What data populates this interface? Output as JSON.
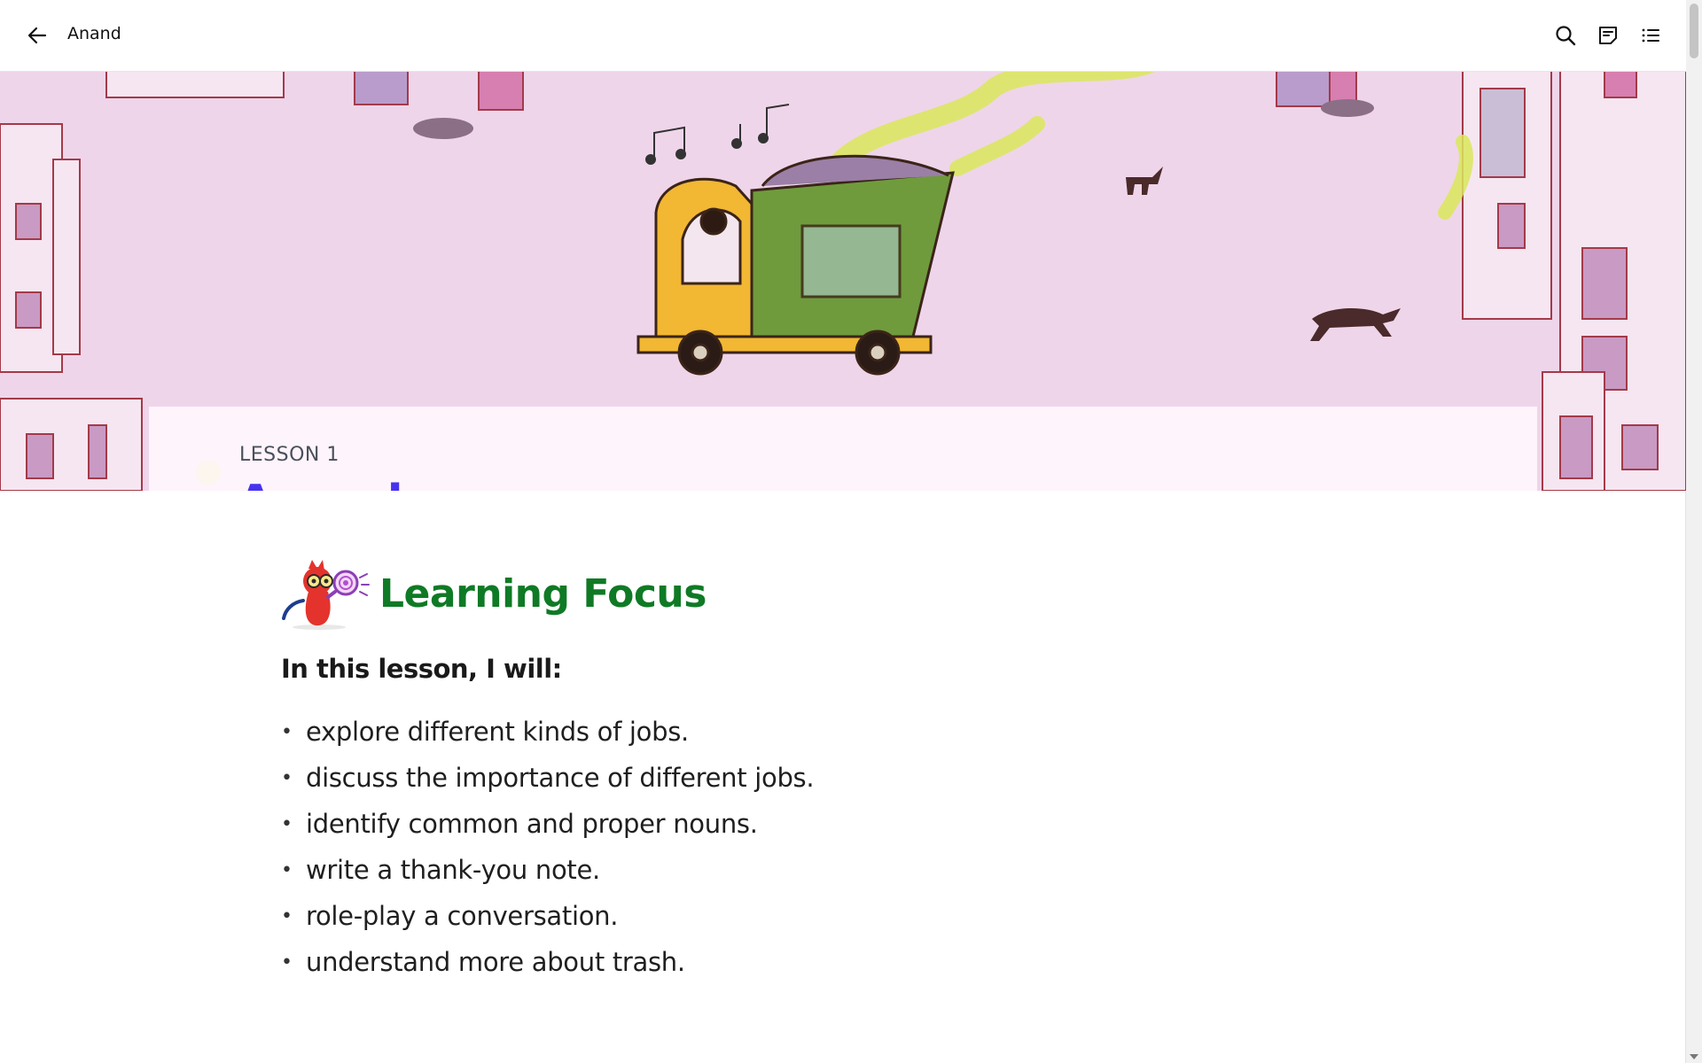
{
  "topbar": {
    "back_icon": "arrow-left-icon",
    "title": "Anand",
    "icons": [
      "search-icon",
      "notes-icon",
      "table-of-contents-icon"
    ]
  },
  "hero": {
    "lesson_label": "LESSON 1",
    "lesson_title": "Anand",
    "image": "illustrated city street with a yellow and green garbage truck"
  },
  "learning_focus": {
    "mascot_icon": "mascot-with-magnifier-icon",
    "title": "Learning Focus",
    "intro": "In this lesson, I will:",
    "items": [
      "explore different kinds of jobs.",
      "discuss the importance of different jobs.",
      "identify common and proper nouns.",
      "write a thank-you note.",
      "role-play a conversation.",
      "understand more about trash."
    ]
  },
  "colors": {
    "lesson_title": "#4733ef",
    "focus_title": "#0f7a25",
    "hero_background": "#efd6ea"
  }
}
